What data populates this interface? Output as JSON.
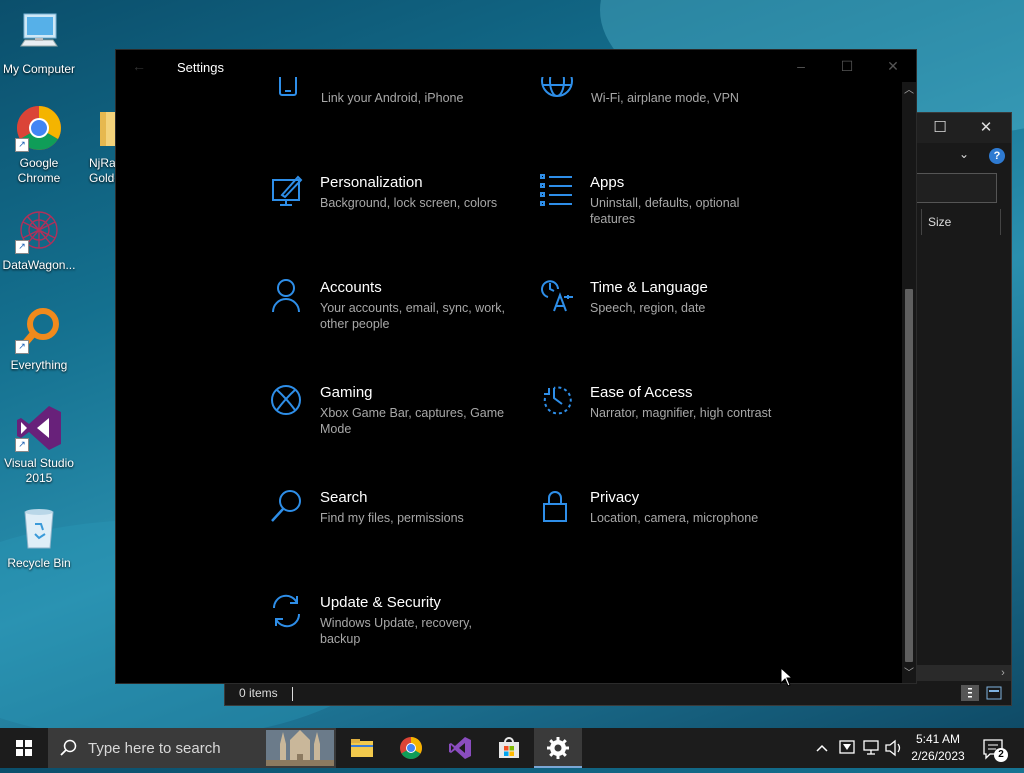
{
  "desktop": {
    "icons": [
      {
        "label": "My Computer"
      },
      {
        "label": "Google Chrome"
      },
      {
        "label": "NjRat Golden"
      },
      {
        "label": "DataWagon..."
      },
      {
        "label": "Everything"
      },
      {
        "label": "Visual Studio 2015"
      },
      {
        "label": "Recycle Bin"
      }
    ]
  },
  "explorer": {
    "column_size": "Size",
    "status_items": "0 items"
  },
  "settings": {
    "title": "Settings",
    "tiles": [
      {
        "name": "",
        "desc": "Link your Android, iPhone",
        "icon": "phone-icon"
      },
      {
        "name": "",
        "desc": "Wi-Fi, airplane mode, VPN",
        "icon": "globe-icon"
      },
      {
        "name": "Personalization",
        "desc": "Background, lock screen, colors",
        "icon": "personalization-icon"
      },
      {
        "name": "Apps",
        "desc": "Uninstall, defaults, optional features",
        "icon": "apps-icon"
      },
      {
        "name": "Accounts",
        "desc": "Your accounts, email, sync, work, other people",
        "icon": "person-icon"
      },
      {
        "name": "Time & Language",
        "desc": "Speech, region, date",
        "icon": "time-language-icon"
      },
      {
        "name": "Gaming",
        "desc": "Xbox Game Bar, captures, Game Mode",
        "icon": "xbox-icon"
      },
      {
        "name": "Ease of Access",
        "desc": "Narrator, magnifier, high contrast",
        "icon": "ease-of-access-icon"
      },
      {
        "name": "Search",
        "desc": "Find my files, permissions",
        "icon": "search-icon"
      },
      {
        "name": "Privacy",
        "desc": "Location, camera, microphone",
        "icon": "lock-icon"
      },
      {
        "name": "Update & Security",
        "desc": "Windows Update, recovery, backup",
        "icon": "update-icon"
      }
    ]
  },
  "taskbar": {
    "search_placeholder": "Type here to search",
    "time": "5:41 AM",
    "date": "2/26/2023",
    "notification_count": "2"
  },
  "colors": {
    "accent": "#2e8ee8",
    "settings_bg": "#000000",
    "taskbar_bg": "#1c1c1c"
  }
}
